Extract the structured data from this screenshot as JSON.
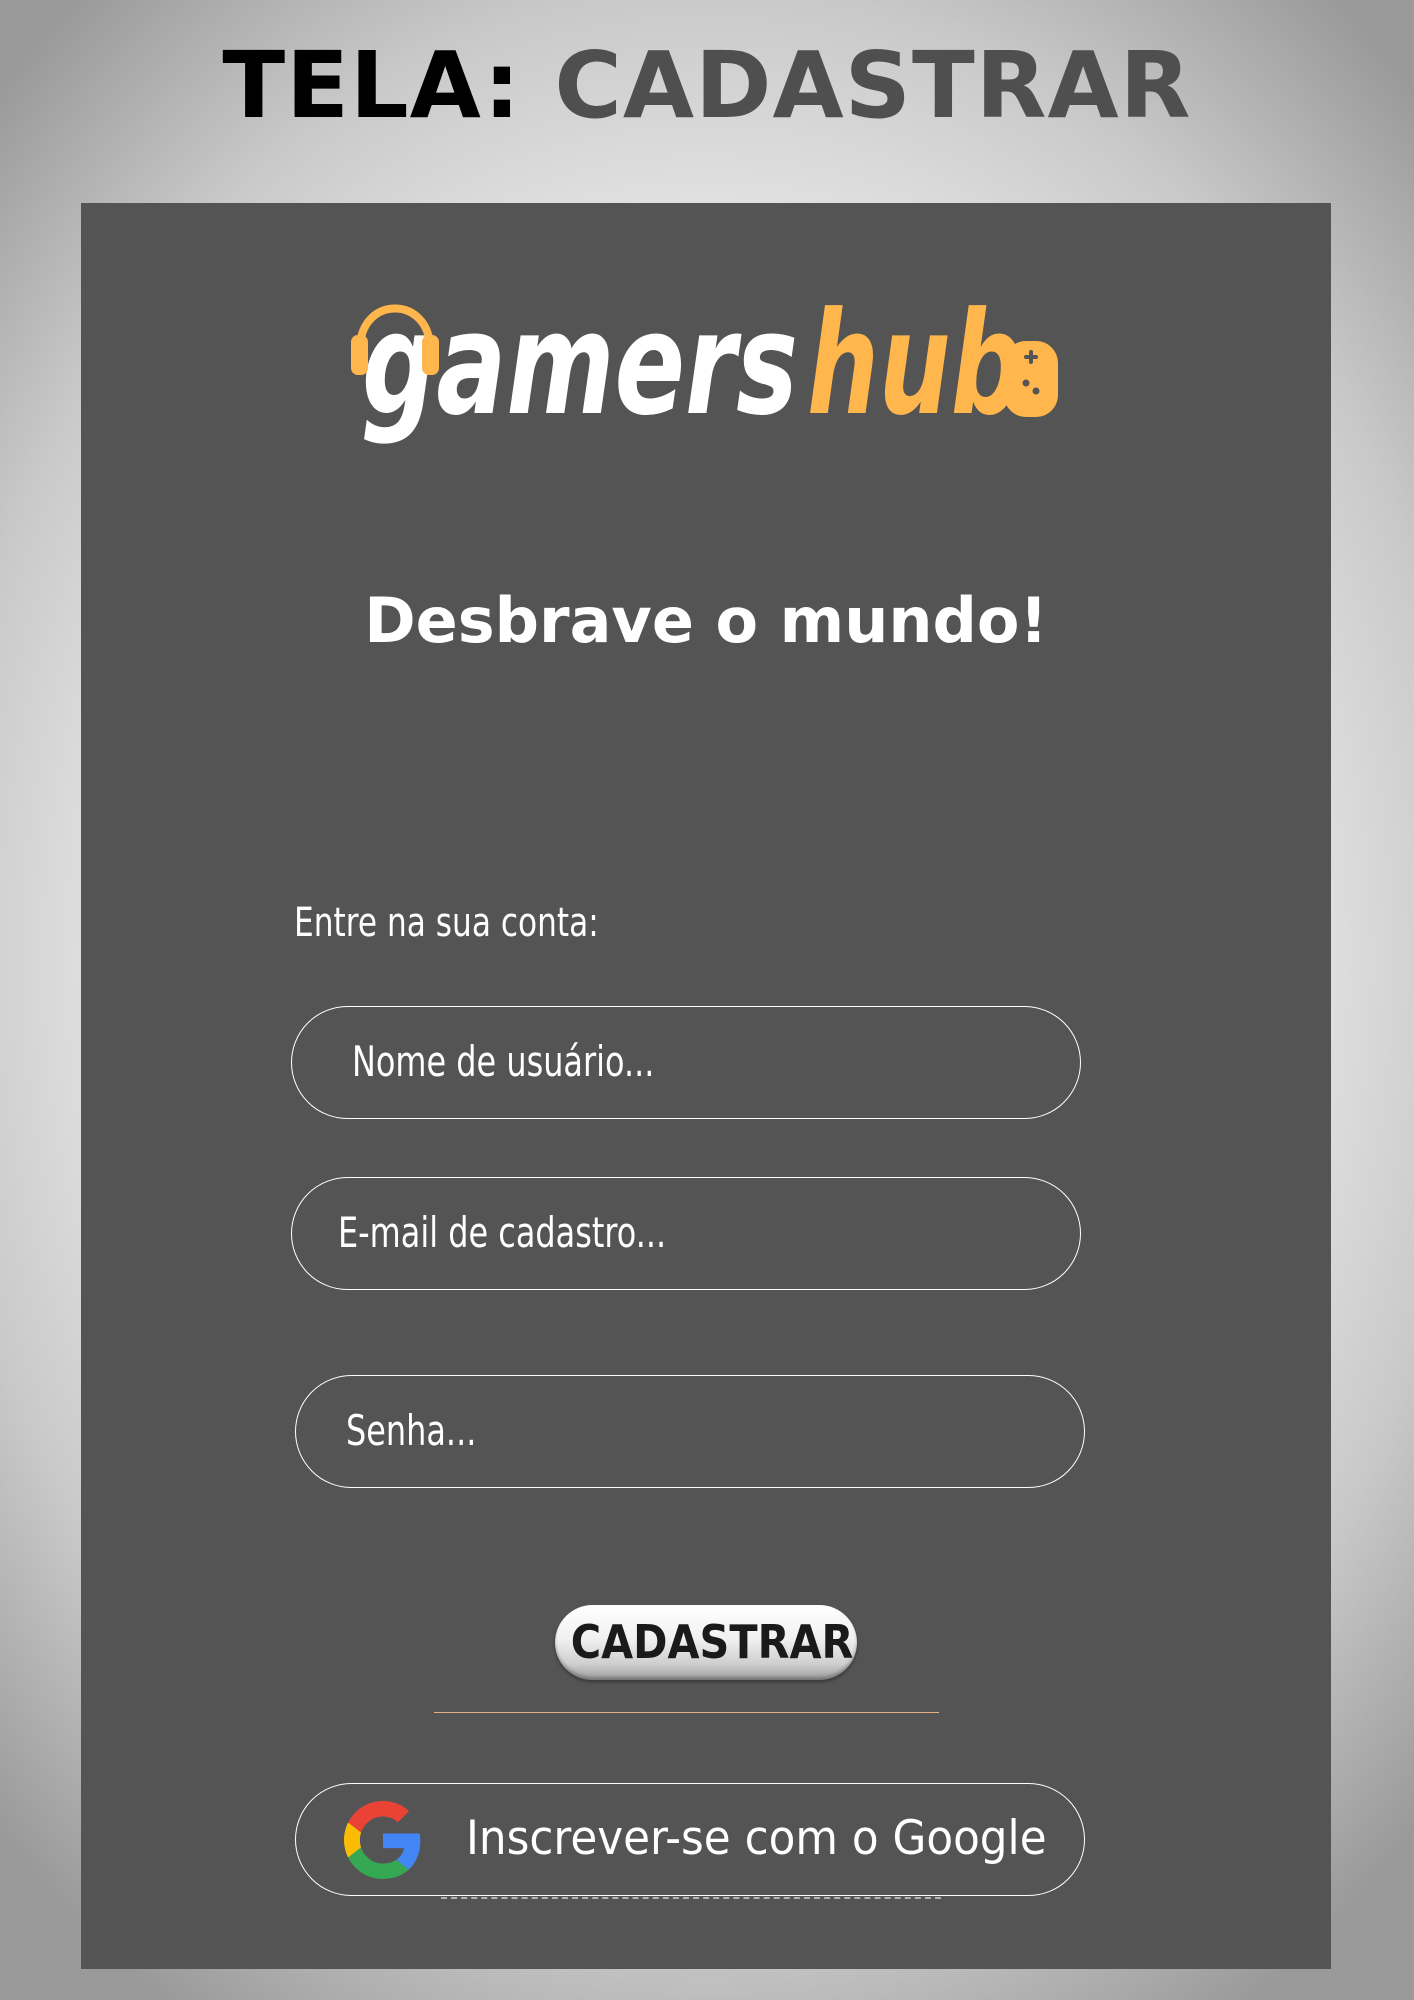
{
  "screen_title": {
    "prefix": "TELA:",
    "name": "CADASTRAR"
  },
  "brand": {
    "logo_text_primary": "gamers",
    "logo_text_accent": "hub",
    "accent_color": "#ffb64c",
    "logo_icons": [
      "headphones-icon",
      "gamepad-icon"
    ]
  },
  "tagline": "Desbrave o mundo!",
  "form": {
    "section_label": "Entre na sua conta:",
    "username_placeholder": "Nome de usuário...",
    "email_placeholder": "E-mail de cadastro...",
    "password_placeholder": "Senha...",
    "submit_label": "CADASTRAR"
  },
  "google_signup": {
    "label": "Inscrever-se com o Google",
    "icon": "google-icon"
  },
  "colors": {
    "panel": "#545454",
    "text": "#ffffff",
    "title_dark": "#000000",
    "title_gray": "#4f4f4f",
    "divider": "#e8b184"
  }
}
